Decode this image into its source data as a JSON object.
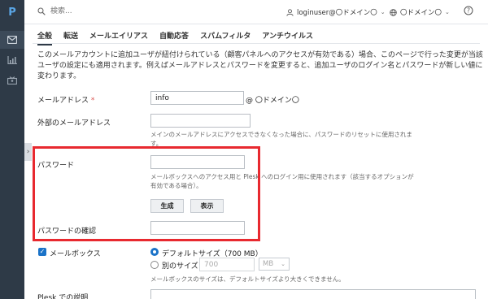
{
  "sidebar": {
    "logo": "P"
  },
  "header": {
    "search_placeholder": "検索...",
    "user": "loginuser@〇ドメイン〇",
    "domain": "〇ドメイン〇"
  },
  "tabs": [
    "全般",
    "転送",
    "メールエイリアス",
    "自動応答",
    "スパムフィルタ",
    "アンチウイルス"
  ],
  "intro": "このメールアカウントに追加ユーザが紐付けられている（顧客パネルへのアクセスが有効である）場合、このページで行った変更が当該ユーザの設定にも適用されます。例えばメールアドレスとパスワードを変更すると、追加ユーザのログイン名とパスワードが新しい値に変わります。",
  "form": {
    "email_label": "メールアドレス",
    "email_required": "*",
    "email_value": "info",
    "email_domain": "@ 〇ドメイン〇",
    "external_label": "外部のメールアドレス",
    "external_value": "",
    "external_hint": "メインのメールアドレスにアクセスできなくなった場合に、パスワードのリセットに使用されます。",
    "password_label": "パスワード",
    "password_value": "",
    "password_hint": "メールボックスへのアクセス用と Plesk へのログイン用に使用されます（該当するオプションが有効である場合）。",
    "generate_label": "生成",
    "show_label": "表示",
    "confirm_label": "パスワードの確認",
    "confirm_value": "",
    "mailbox_label": "メールボックス",
    "mailbox_checked": true,
    "size_default_label": "デフォルトサイズ（700 MB）",
    "size_custom_label": "別のサイズ",
    "size_custom_value": "700",
    "size_unit": "MB",
    "size_hint": "メールボックスのサイズは、デフォルトサイズより大きくできません。",
    "desc_label": "Plesk での説明"
  },
  "colors": {
    "sidebar": "#2e3a47",
    "highlight": "#e8292f",
    "accent": "#1b73c8"
  }
}
